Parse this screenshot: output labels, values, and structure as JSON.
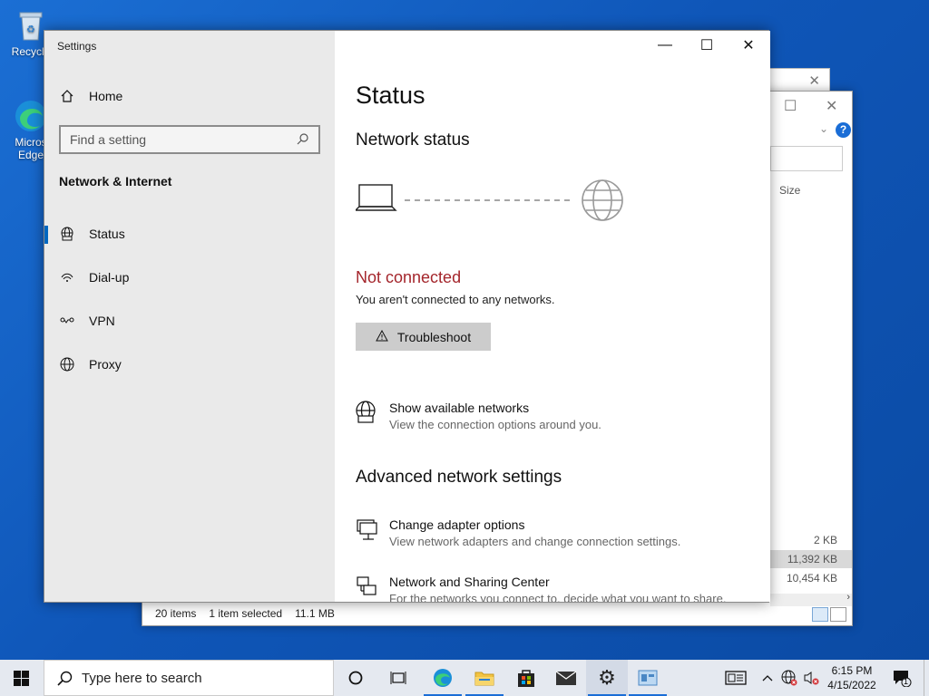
{
  "desktop": {
    "recycle_label": "Recycle",
    "edge_label_1": "Micros",
    "edge_label_2": "Edge"
  },
  "explorer": {
    "items_count": "20 items",
    "selected": "1 item selected",
    "selected_size": "11.1 MB",
    "column_size": "Size",
    "sizes": [
      "2 KB",
      "11,392 KB",
      "10,454 KB"
    ]
  },
  "settings": {
    "window_title": "Settings",
    "home_label": "Home",
    "search_placeholder": "Find a setting",
    "section_title": "Network & Internet",
    "nav": [
      {
        "label": "Status",
        "icon": "status-globe-icon"
      },
      {
        "label": "Dial-up",
        "icon": "dialup-icon"
      },
      {
        "label": "VPN",
        "icon": "vpn-icon"
      },
      {
        "label": "Proxy",
        "icon": "proxy-globe-icon"
      }
    ],
    "page_title": "Status",
    "network_status_heading": "Network status",
    "connection_state": "Not connected",
    "connection_desc": "You aren't connected to any networks.",
    "troubleshoot_label": "Troubleshoot",
    "show_networks_title": "Show available networks",
    "show_networks_desc": "View the connection options around you.",
    "advanced_heading": "Advanced network settings",
    "adapter_title": "Change adapter options",
    "adapter_desc": "View network adapters and change connection settings.",
    "sharing_title": "Network and Sharing Center",
    "sharing_desc": "For the networks you connect to, decide what you want to share."
  },
  "taskbar": {
    "search_placeholder": "Type here to search",
    "time": "6:15 PM",
    "date": "4/15/2022",
    "notification_count": "1"
  },
  "colors": {
    "accent": "#0067c0",
    "not_connected": "#a4262c"
  }
}
